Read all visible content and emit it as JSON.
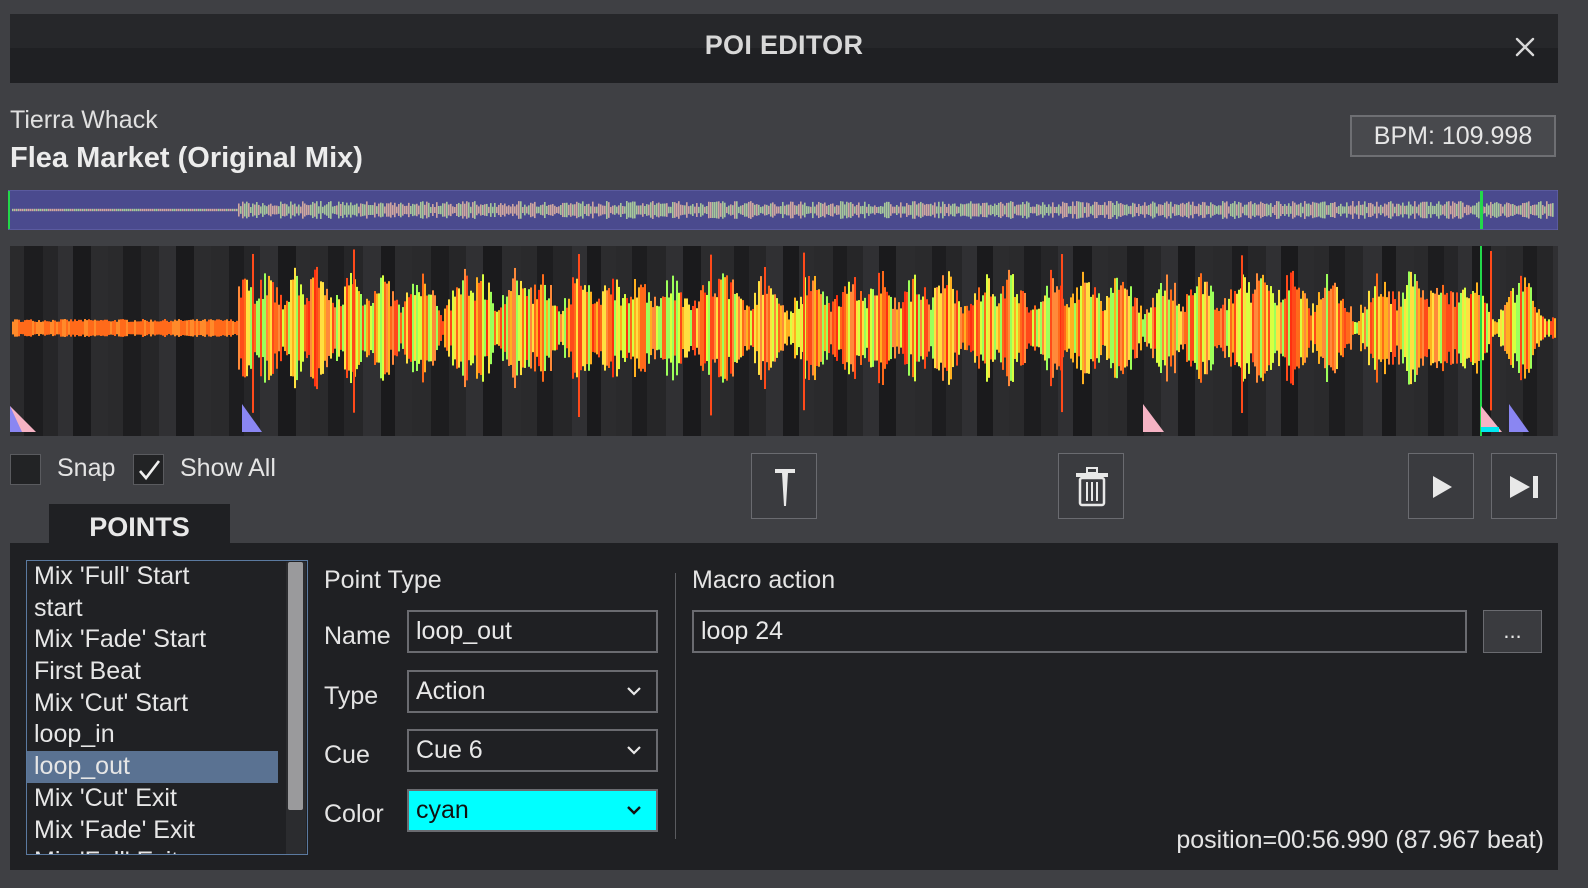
{
  "window": {
    "title": "POI EDITOR",
    "close_icon": "close-icon"
  },
  "track": {
    "artist": "Tierra Whack",
    "title": "Flea Market (Original Mix)",
    "bpm": "BPM: 109.998"
  },
  "waveform": {
    "playhead_fraction": 0.951,
    "playhead_color": "#23d84a",
    "overview_bg": "#4a4a8e"
  },
  "controls": {
    "snap": {
      "label": "Snap",
      "checked": false
    },
    "show_all": {
      "label": "Show All",
      "checked": true
    },
    "add_marker_icon": "marker-pin-icon",
    "delete_icon": "trash-icon",
    "play_icon": "play-icon",
    "next_icon": "skip-next-icon"
  },
  "tabs": [
    {
      "label": "POINTS",
      "active": true
    }
  ],
  "points_list": {
    "items": [
      "Mix 'Full' Start",
      "start",
      "Mix 'Fade' Start",
      "First Beat",
      "Mix 'Cut' Start",
      "loop_in",
      "loop_out",
      "Mix 'Cut' Exit",
      "Mix 'Fade' Exit",
      "Mix 'Full' Exit"
    ],
    "selected_index": 6
  },
  "point_type": {
    "heading": "Point Type",
    "name_label": "Name",
    "name_value": "loop_out",
    "type_label": "Type",
    "type_value": "Action",
    "cue_label": "Cue",
    "cue_value": "Cue 6",
    "color_label": "Color",
    "color_value": "cyan",
    "color_hex": "#00ffff"
  },
  "macro": {
    "heading": "Macro action",
    "value": "loop 24",
    "browse_label": "..."
  },
  "status": {
    "position": "position=00:56.990 (87.967 beat)"
  }
}
